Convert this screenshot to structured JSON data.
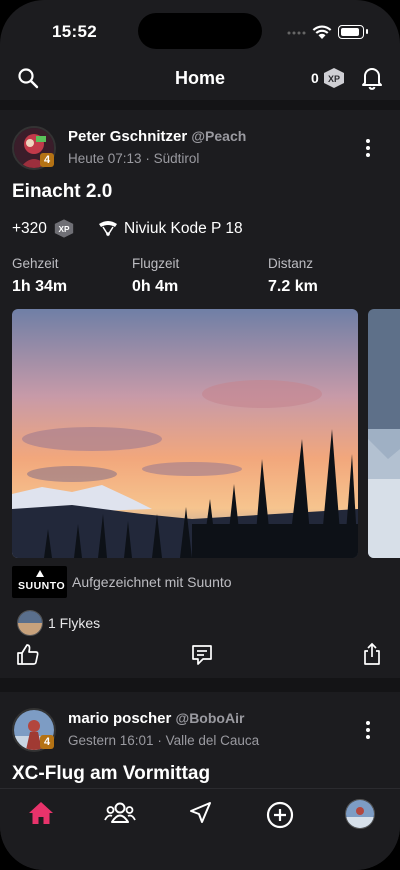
{
  "status_bar": {
    "time": "15:52"
  },
  "header": {
    "title": "Home",
    "xp_count": "0",
    "xp_label": "XP"
  },
  "colors": {
    "accent": "#e8336b",
    "level_badge": "#b47214",
    "background": "#1c1c1f"
  },
  "posts": [
    {
      "user_name": "Peter Gschnitzer",
      "handle": "@Peach",
      "level": "4",
      "time": "Heute 07:13",
      "location": "· Südtirol",
      "title": "Einacht 2.0",
      "xp_gain": "+320",
      "xp_label": "XP",
      "wing": "Niviuk Kode P 18",
      "stats": [
        {
          "label": "Gehzeit",
          "value": "1h 34m"
        },
        {
          "label": "Flugzeit",
          "value": "0h 4m"
        },
        {
          "label": "Distanz",
          "value": "7.2 km"
        }
      ],
      "device_logo": "SUUNTO",
      "recorded_with": "Aufgezeichnet mit Suunto",
      "flykes": "1 Flykes"
    },
    {
      "user_name": "mario poscher",
      "handle": "@BoboAir",
      "level": "4",
      "time": "Gestern 16:01",
      "location": "· Valle del Cauca",
      "title": "XC-Flug am Vormittag"
    }
  ],
  "icons": [
    "search-icon",
    "xp-badge-icon",
    "bell-icon",
    "kebab-menu-icon",
    "paraglider-wing-icon",
    "thumbs-up-icon",
    "comment-icon",
    "share-icon",
    "home-icon",
    "people-icon",
    "navigation-icon",
    "add-circle-icon"
  ]
}
